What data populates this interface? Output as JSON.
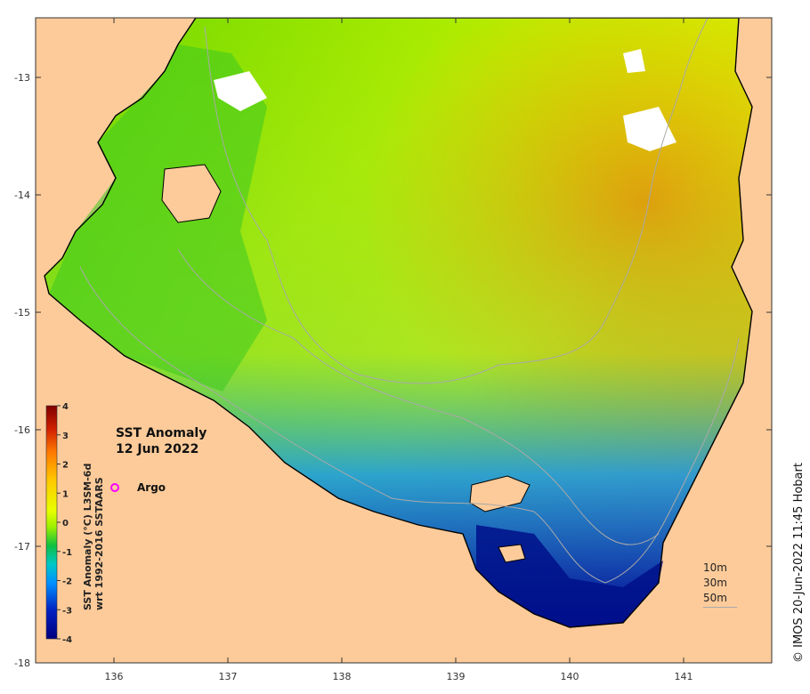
{
  "map": {
    "title_line1": "SST Anomaly",
    "title_line2": "12 Jun 2022",
    "x_ticks": [
      "136",
      "137",
      "138",
      "139",
      "140",
      "141"
    ],
    "y_ticks": [
      "-13",
      "-14",
      "-15",
      "-16",
      "-17",
      "-18"
    ],
    "credit": "© IMOS 20-Jun-2022 11:45 Hobart",
    "land_color": "#fdcb9a",
    "coast_color": "#000000",
    "isobath_color": "#a9a9a9"
  },
  "colorbar": {
    "title_line1": "SST Anomaly (°C) L3SM-6d",
    "title_line2": "wrt 1992-2016 SSTAARS",
    "ticks": [
      "4",
      "3",
      "2",
      "1",
      "0",
      "-1",
      "-2",
      "-3",
      "-4"
    ],
    "colors": [
      "#7f0000",
      "#d02000",
      "#ff7a00",
      "#ffc800",
      "#cfff00",
      "#7cf000",
      "#10c040",
      "#00c8c8",
      "#0080ff",
      "#0020c0",
      "#00007f"
    ]
  },
  "legend": {
    "argo_label": "Argo",
    "argo_color": "#ff00ff",
    "depths": [
      "10m",
      "30m",
      "50m"
    ]
  }
}
